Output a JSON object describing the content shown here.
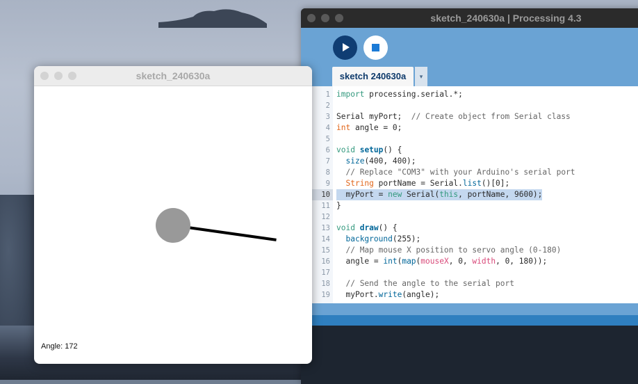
{
  "ide": {
    "title": "sketch_240630a | Processing 4.3",
    "tab_label": "sketch 240630a",
    "tab_menu_glyph": "▾",
    "code_lines": [
      {
        "n": "1",
        "html": "<span style='color:#33997e'>import</span> processing.serial.*;"
      },
      {
        "n": "2",
        "html": ""
      },
      {
        "n": "3",
        "html": "Serial myPort;  <span style='color:#666'>// Create object from Serial class</span>"
      },
      {
        "n": "4",
        "html": "<span style='color:#e2661a'>int</span> angle = 0;"
      },
      {
        "n": "5",
        "html": ""
      },
      {
        "n": "6",
        "html": "<span style='color:#33997e'>void</span> <b style='color:#006699'>setup</b>() {"
      },
      {
        "n": "7",
        "html": "  <span style='color:#006699'>size</span>(400, 400);"
      },
      {
        "n": "8",
        "html": "  <span style='color:#666'>// Replace \"COM3\" with your Arduino's serial port</span>"
      },
      {
        "n": "9",
        "html": "  <span style='color:#e2661a'>String</span> portName = Serial.<span style='color:#006699'>list</span>()[0];"
      },
      {
        "n": "10",
        "html": "  myPort = <span style='color:#33997e'>new</span> Serial(<span style='color:#33997e'>this</span>, portName, 9600);",
        "highlight": true
      },
      {
        "n": "11",
        "html": "}"
      },
      {
        "n": "12",
        "html": ""
      },
      {
        "n": "13",
        "html": "<span style='color:#33997e'>void</span> <b style='color:#006699'>draw</b>() {"
      },
      {
        "n": "14",
        "html": "  <span style='color:#006699'>background</span>(255);"
      },
      {
        "n": "15",
        "html": "  <span style='color:#666'>// Map mouse X position to servo angle (0-180)</span>"
      },
      {
        "n": "16",
        "html": "  angle = <span style='color:#006699'>int</span>(<span style='color:#006699'>map</span>(<span style='color:#d94a7a'>mouseX</span>, 0, <span style='color:#d94a7a'>width</span>, 0, 180));"
      },
      {
        "n": "17",
        "html": ""
      },
      {
        "n": "18",
        "html": "  <span style='color:#666'>// Send the angle to the serial port</span>"
      },
      {
        "n": "19",
        "html": "  myPort.<span style='color:#006699'>write</span>(angle);"
      }
    ]
  },
  "sketch": {
    "title": "sketch_240630a",
    "angle_text": "Angle: 172",
    "angle_value": 172
  }
}
